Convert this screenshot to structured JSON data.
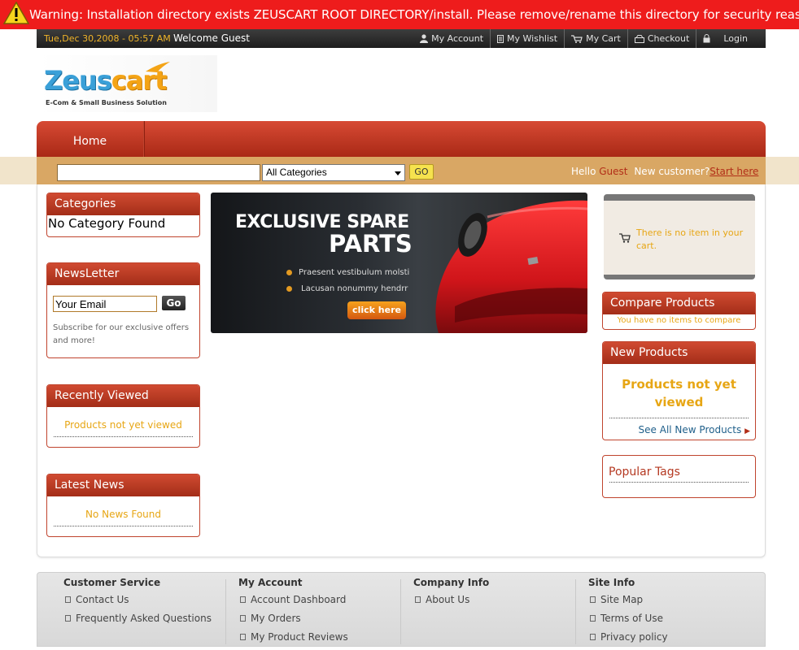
{
  "warning": {
    "text": "Warning: Installation directory exists ZEUSCART ROOT DIRECTORY/install. Please remove/rename this directory for security reasons."
  },
  "topbar": {
    "date": "Tue,Dec 30,2008 - 05:57 AM",
    "welcome": "Welcome Guest",
    "links": [
      "My Account",
      "My Wishlist",
      "My Cart",
      "Checkout",
      "Login"
    ]
  },
  "logo": {
    "brand_part1": "Zeus",
    "brand_part2": "cart",
    "tagline": "E-Com & Small Business Solution"
  },
  "nav": {
    "home": "Home"
  },
  "search": {
    "input_value": "",
    "category": "All Categories",
    "go": "GO",
    "hello": "Hello",
    "guest": "Guest",
    "new_customer": "New customer?",
    "start_here": "Start here"
  },
  "categories": {
    "title": "Categories",
    "empty": "No Category Found"
  },
  "newsletter": {
    "title": "NewsLetter",
    "email_value": "Your Email",
    "go": "Go",
    "note": "Subscribe for our exclusive offers and more!"
  },
  "recently_viewed": {
    "title": "Recently Viewed",
    "empty": "Products not yet viewed"
  },
  "latest_news": {
    "title": "Latest News",
    "empty": "No News Found"
  },
  "banner": {
    "line1": "EXCLUSIVE SPARE",
    "line2": "PARTS",
    "bullet1": "Praesent vestibulum molsti",
    "bullet2": "Lacusan nonummy hendrr",
    "button": "click here"
  },
  "cart": {
    "empty": "There is no item in your cart."
  },
  "compare": {
    "title": "Compare Products",
    "empty": "You have no items to compare"
  },
  "new_products": {
    "title": "New Products",
    "empty": "Products not yet viewed",
    "see_all": "See All New Products"
  },
  "popular_tags": {
    "title": "Popular Tags"
  },
  "footer": {
    "columns": [
      {
        "title": "Customer Service",
        "items": [
          "Contact Us",
          "Frequently Asked Questions"
        ]
      },
      {
        "title": "My Account",
        "items": [
          "Account Dashboard",
          "My Orders",
          "My Product Reviews"
        ]
      },
      {
        "title": "Company Info",
        "items": [
          "About Us"
        ]
      },
      {
        "title": "Site Info",
        "items": [
          "Site Map",
          "Terms of Use",
          "Privacy policy"
        ]
      }
    ]
  },
  "colors": {
    "warning_red": "#ee1c1c",
    "brand_red": "#b53922",
    "accent_orange": "#e7a614",
    "search_tan": "#d9a764"
  }
}
